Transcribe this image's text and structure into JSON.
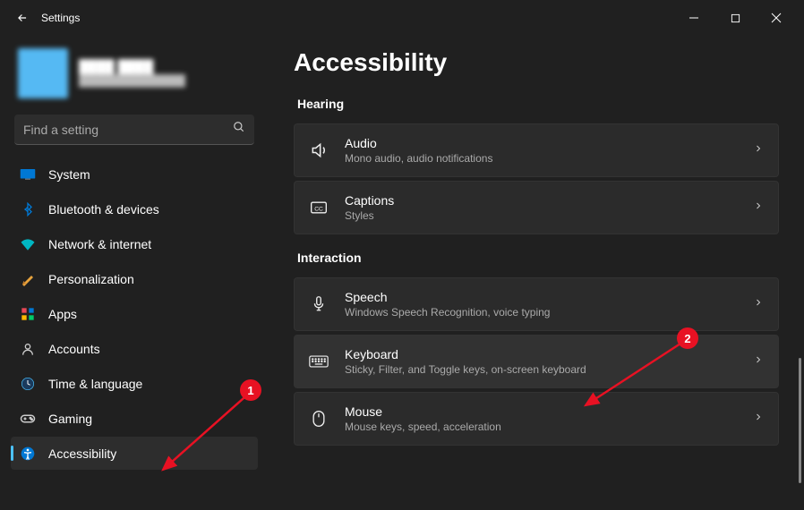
{
  "window": {
    "title": "Settings"
  },
  "profile": {
    "name": "████ ████",
    "email": "██████████████"
  },
  "search": {
    "placeholder": "Find a setting"
  },
  "sidebar": {
    "items": [
      {
        "label": "System",
        "icon": "system"
      },
      {
        "label": "Bluetooth & devices",
        "icon": "bluetooth"
      },
      {
        "label": "Network & internet",
        "icon": "network"
      },
      {
        "label": "Personalization",
        "icon": "personalization"
      },
      {
        "label": "Apps",
        "icon": "apps"
      },
      {
        "label": "Accounts",
        "icon": "accounts"
      },
      {
        "label": "Time & language",
        "icon": "time"
      },
      {
        "label": "Gaming",
        "icon": "gaming"
      },
      {
        "label": "Accessibility",
        "icon": "accessibility"
      }
    ],
    "active_index": 8
  },
  "page": {
    "title": "Accessibility",
    "sections": [
      {
        "label": "Hearing",
        "items": [
          {
            "icon": "audio",
            "title": "Audio",
            "sub": "Mono audio, audio notifications"
          },
          {
            "icon": "captions",
            "title": "Captions",
            "sub": "Styles"
          }
        ]
      },
      {
        "label": "Interaction",
        "items": [
          {
            "icon": "speech",
            "title": "Speech",
            "sub": "Windows Speech Recognition, voice typing"
          },
          {
            "icon": "keyboard",
            "title": "Keyboard",
            "sub": "Sticky, Filter, and Toggle keys, on-screen keyboard",
            "highlight": true
          },
          {
            "icon": "mouse",
            "title": "Mouse",
            "sub": "Mouse keys, speed, acceleration"
          }
        ]
      }
    ]
  },
  "annotations": {
    "badge1": "1",
    "badge2": "2"
  }
}
